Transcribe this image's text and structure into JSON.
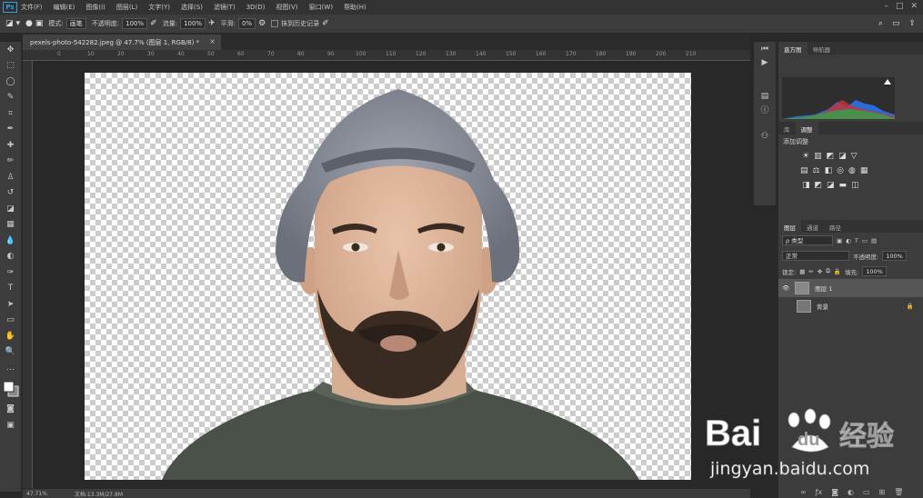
{
  "menu": {
    "items": [
      "文件(F)",
      "编辑(E)",
      "图像(I)",
      "图层(L)",
      "文字(Y)",
      "选择(S)",
      "滤镜(T)",
      "3D(D)",
      "视图(V)",
      "窗口(W)",
      "帮助(H)"
    ]
  },
  "options": {
    "mode_label": "模式:",
    "mode_value": "画笔",
    "opacity_label": "不透明度:",
    "opacity_value": "100%",
    "flow_label": "流量:",
    "flow_value": "100%",
    "smooth_label": "平滑:",
    "smooth_value": "0%",
    "history_label": "抹到历史记录"
  },
  "doc": {
    "tab_title": "pexels-photo-542282.jpeg @ 47.7% (图层 1, RGB/8) *",
    "close": "×"
  },
  "ruler": {
    "ticks": [
      "0",
      "10",
      "20",
      "30",
      "40",
      "50",
      "60",
      "70",
      "80",
      "90",
      "100",
      "110",
      "120",
      "130",
      "140",
      "150",
      "160",
      "170",
      "180",
      "190",
      "200",
      "210"
    ]
  },
  "status": {
    "zoom": "47.71%",
    "doc_size": "文档:13.3M/27.8M"
  },
  "panels": {
    "top_tabs": [
      "直方图",
      "导航器"
    ],
    "adj_tabs": [
      "库",
      "调整"
    ],
    "adj_title": "添加调整",
    "layer_tabs": [
      "图层",
      "通道",
      "路径"
    ],
    "filter": "ρ 类型",
    "blend": "正常",
    "opacity_label": "不透明度:",
    "opacity_value": "100%",
    "lock_label": "锁定:",
    "fill_label": "填充:",
    "fill_value": "100%",
    "layers": [
      {
        "name": "图层 1"
      },
      {
        "name": "背景"
      }
    ]
  },
  "watermark": {
    "brand_a": "Bai",
    "brand_b": "du",
    "brand_c": "经验",
    "url": "jingyan.baidu.com"
  }
}
